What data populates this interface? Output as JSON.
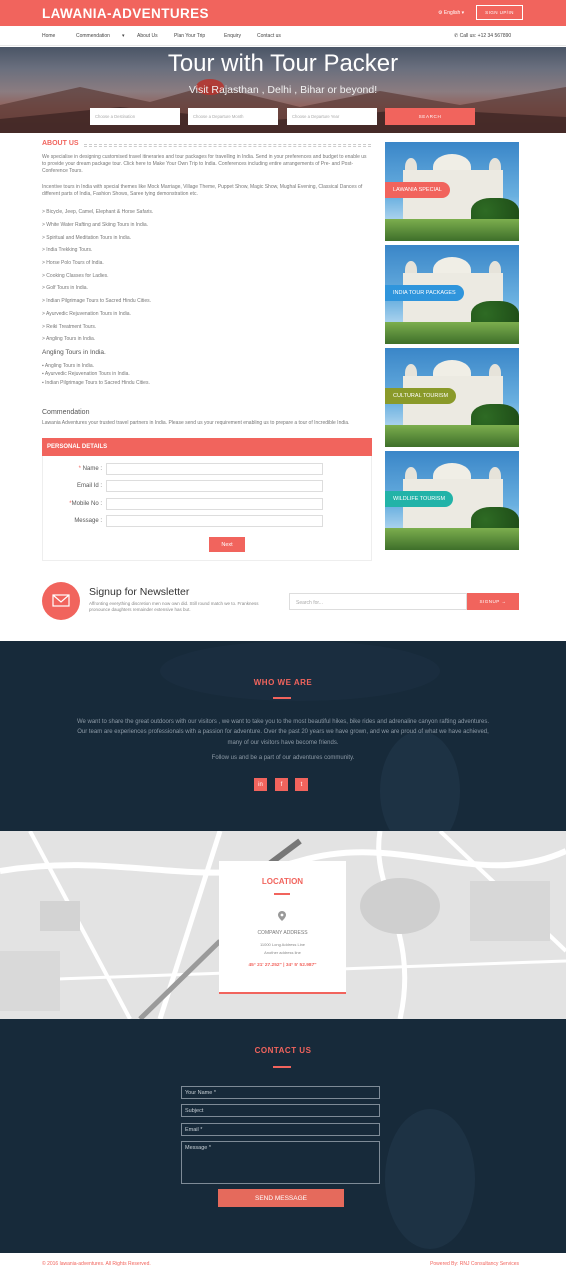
{
  "header": {
    "logo": "LAWANIA-ADVENTURES",
    "language": "English",
    "signup": "SIGN UP/IN",
    "nav": [
      "Home",
      "Commendation",
      "About Us",
      "Plan Your Trip",
      "Enquiry",
      "Contact us"
    ],
    "call": "Call us: +12 34 567890"
  },
  "hero": {
    "title": "Tour with Tour Packer",
    "subtitle": "Visit Rajasthan , Delhi , Bihar or beyond!",
    "fields": [
      "Choose a Destination",
      "Choose a Departure Month",
      "Choose a Departure Year"
    ],
    "search": "SEARCH"
  },
  "about": {
    "heading": "ABOUT US",
    "para1": "We specialise in designing customised travel itineraries and tour packages for travelling in India. Send in your preferences and budget to enable us to provide your dream package tour. Click here to Make Your Own Trip to India. Conferences including entire arrangements of Pre- and Post-Conference Tours.",
    "para2": "Incentive tours in India with special themes like Mock Marriage, Village Theme, Puppet Show, Magic Show, Mughal Evening, Classical Dances of different parts of India, Fashion Shows, Saree tying demonstration etc.",
    "list": [
      "> Bicycle, Jeep, Camel, Elephant & Horse Safaris.",
      "> White Water Rafting and Skiing Tours in India.",
      "> Spiritual and Meditation Tours in India.",
      "> India Trekking Tours.",
      "> Horse Polo Tours of India.",
      "> Cooking Classes for Ladies.",
      "> Golf Tours in India.",
      "> Indian Pilgrimage Tours to Sacred Hindu Cities.",
      "> Ayurvedic Rejuvenation Tours in India.",
      "> Reiki Treatment Tours.",
      "> Angling Tours in India."
    ],
    "angling_heading": "Angling Tours in India.",
    "angling_list": [
      "Angling Tours in India.",
      "Ayurvedic Rejuvenation Tours in India.",
      "Indian Pilgrimage Tours to Sacred Hindu Cities."
    ]
  },
  "commendation": {
    "heading": "Commendation",
    "text": "Lawania Adventures your trusted travel partners in India. Please send us your requirement enabling us to prepare a tour of Incredible India."
  },
  "form": {
    "heading": "PERSONAL DETAILS",
    "name_label": "Name :",
    "email_label": "Email Id :",
    "mobile_label": "Mobile No :",
    "message_label": "Message :",
    "required_mark": "*",
    "next": "Next"
  },
  "tour_cards": [
    {
      "label": "LAWANIA SPECIAL",
      "color": "#f1645d"
    },
    {
      "label": "INDIA TOUR PACKAGES",
      "color": "#2f95dc"
    },
    {
      "label": "CULTURAL TOURISM",
      "color": "#8a9a2a"
    },
    {
      "label": "WILDLIFE TOURISM",
      "color": "#22b3a8"
    }
  ],
  "newsletter": {
    "title": "Signup for Newsletter",
    "text": "Affronting everything discretion men now own did. Still round match we to. Frankness pronounce daughters remainder extensive has but.",
    "placeholder": "Search for...",
    "button": "SIGNUP →"
  },
  "who": {
    "heading": "WHO WE ARE",
    "text": "We want to share the great outdoors with our visitors , we want to take you to the most beautiful hikes, bike rides and adrenaline canyon rafting adventures. Our team are experiences professionals with a passion for adventure. Over the past 20 years we have grown, and we are proud of what we have achieved, many of our visitors have become friends.",
    "follow": "Follow us and be a part of our adventures community.",
    "social": [
      "in",
      "f",
      "t"
    ]
  },
  "location": {
    "heading": "LOCATION",
    "company": "COMPANY ADDRESS",
    "line1": "11000 Long Address Line",
    "line2": "Another address line",
    "coords": "45° 21' 27.252\" | 34° 5' 52.987\""
  },
  "contact": {
    "heading": "CONTACT US",
    "name": "Your Name *",
    "subject": "Subject",
    "email": "Email *",
    "message": "Message *",
    "button": "SEND MESSAGE"
  },
  "footer": {
    "copyright": "© 2016 lawania-adventures. All Rights Reserved.",
    "powered": "Powered By: RNJ Consultancy Services"
  }
}
